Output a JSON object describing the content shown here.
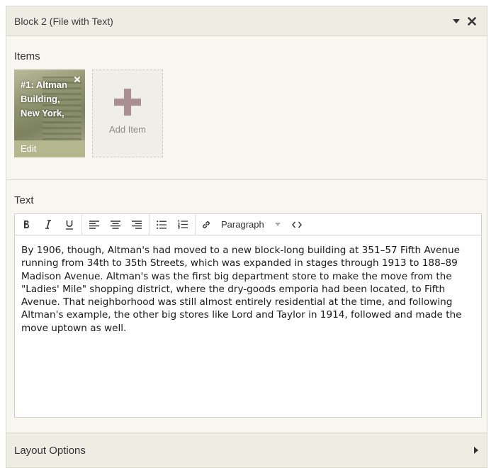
{
  "block": {
    "title": "Block 2 (File with Text)"
  },
  "items_section": {
    "title": "Items",
    "items": [
      {
        "caption": "#1: Altman Building, New York,",
        "edit_label": "Edit"
      }
    ],
    "add_label": "Add Item"
  },
  "text_section": {
    "title": "Text",
    "toolbar": {
      "format_value": "Paragraph"
    },
    "content": "By 1906, though, Altman's had moved to a new block-long building at 351–57 Fifth Avenue running from 34th to 35th Streets, which was expanded in stages through 1913 to 188–89 Madison Avenue. Altman's was the first big department store to make the move from the \"Ladies' Mile\" shopping district, where the dry-goods emporia had been located, to Fifth Avenue. That neighborhood was still almost entirely residential at the time, and following Altman's example, the other big stores like Lord and Taylor in 1914, followed and made the move uptown as well."
  },
  "layout_options": {
    "title": "Layout Options"
  },
  "icons": {
    "collapse": "caret-down-icon",
    "remove": "close-icon",
    "expand": "caret-right-icon"
  },
  "colors": {
    "header_bg": "#eeede4",
    "panel_bg": "#f7f6f1",
    "add_plus": "#a98f8f",
    "edit_bar": "#b4b88f"
  }
}
